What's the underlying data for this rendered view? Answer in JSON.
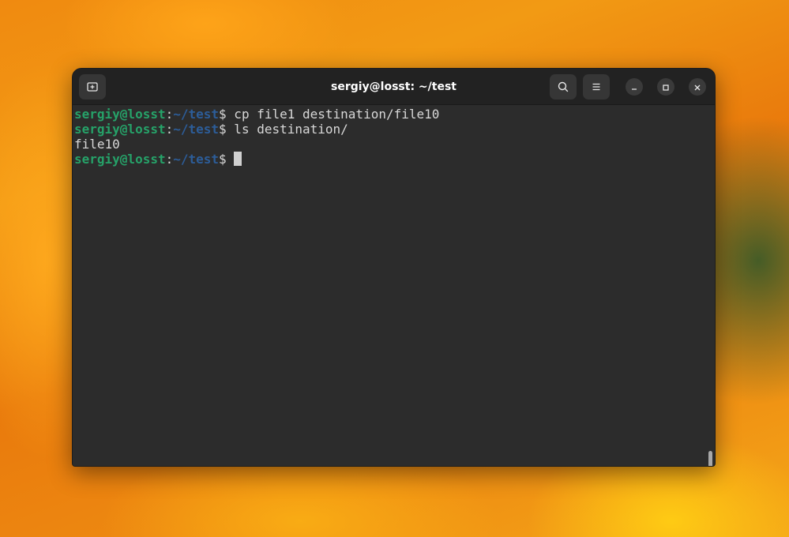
{
  "window": {
    "title": "sergiy@losst: ~/test"
  },
  "toolbar": {
    "new_tab_icon": "new-tab-icon",
    "search_icon": "search-icon",
    "menu_icon": "hamburger-menu-icon",
    "minimize_icon": "minimize-icon",
    "maximize_icon": "maximize-icon",
    "close_icon": "close-icon"
  },
  "terminal": {
    "lines": [
      {
        "prompt_user": "sergiy@losst",
        "prompt_colon": ":",
        "prompt_path": "~/test",
        "prompt_symbol": "$",
        "command": " cp file1 destination/file10"
      },
      {
        "prompt_user": "sergiy@losst",
        "prompt_colon": ":",
        "prompt_path": "~/test",
        "prompt_symbol": "$",
        "command": " ls destination/"
      },
      {
        "output": "file10"
      },
      {
        "prompt_user": "sergiy@losst",
        "prompt_colon": ":",
        "prompt_path": "~/test",
        "prompt_symbol": "$",
        "command": " "
      }
    ]
  },
  "colors": {
    "prompt_user": "#26a269",
    "prompt_path": "#2c5d99",
    "terminal_bg": "#2c2c2c",
    "titlebar_bg": "#222222",
    "text": "#d8d8d8"
  }
}
